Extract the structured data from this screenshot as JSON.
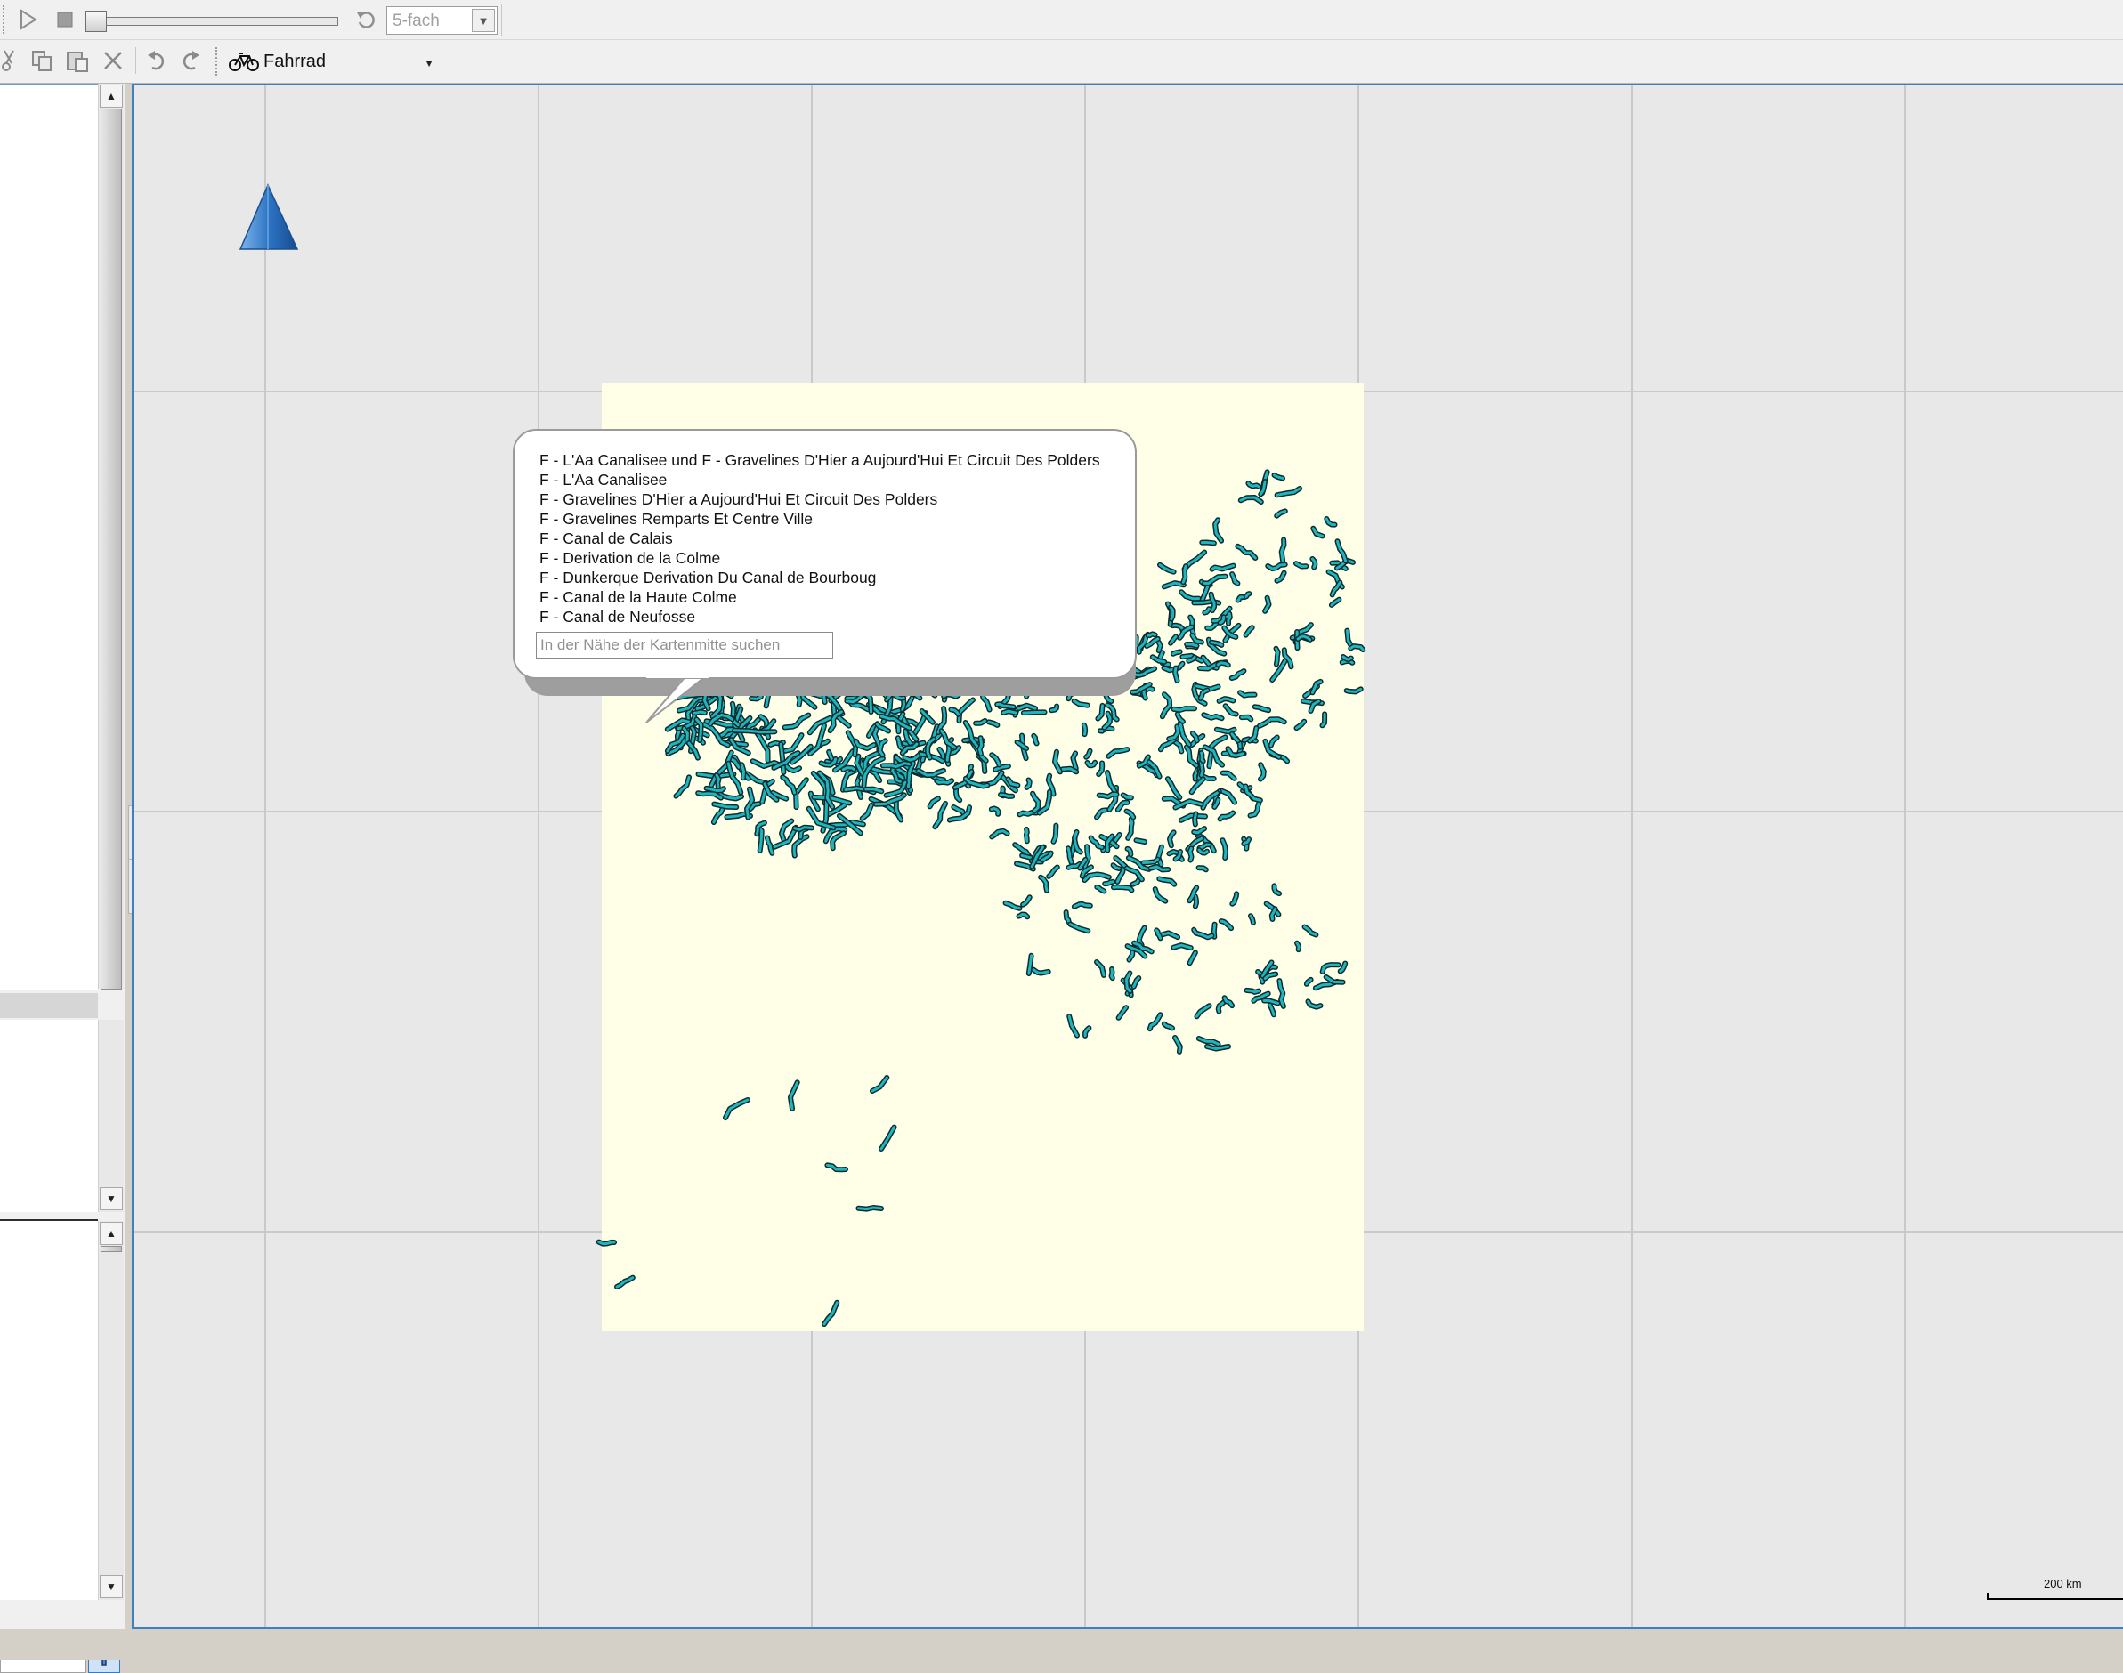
{
  "toolbar": {
    "speed": {
      "value": "5-fach",
      "options": [
        "5-fach"
      ]
    },
    "profile": {
      "value": "Fahrrad",
      "icon": "bicycle-icon"
    }
  },
  "map": {
    "background_color": "#e8e8e8",
    "grid_color": "#c9c9c9",
    "area_color": "#fffee6",
    "route_color": "#1fb5bd",
    "route_outline": "#0a2a2e",
    "scale_label": "200 km",
    "north_marker_color": "#2d74c4"
  },
  "popup": {
    "items": [
      "F - L'Aa Canalisee und F - Gravelines D'Hier a Aujourd'Hui Et Circuit Des Polders",
      "F - L'Aa Canalisee",
      "F - Gravelines D'Hier a Aujourd'Hui Et Circuit Des Polders",
      "F - Gravelines Remparts Et Centre Ville",
      "F - Canal de Calais",
      "F - Derivation de la Colme",
      "F - Dunkerque Derivation Du Canal de Bourboug",
      "F - Canal de la Haute Colme",
      "F - Canal de Neufosse"
    ],
    "search_placeholder": "In der Nähe der Kartenmitte suchen"
  }
}
